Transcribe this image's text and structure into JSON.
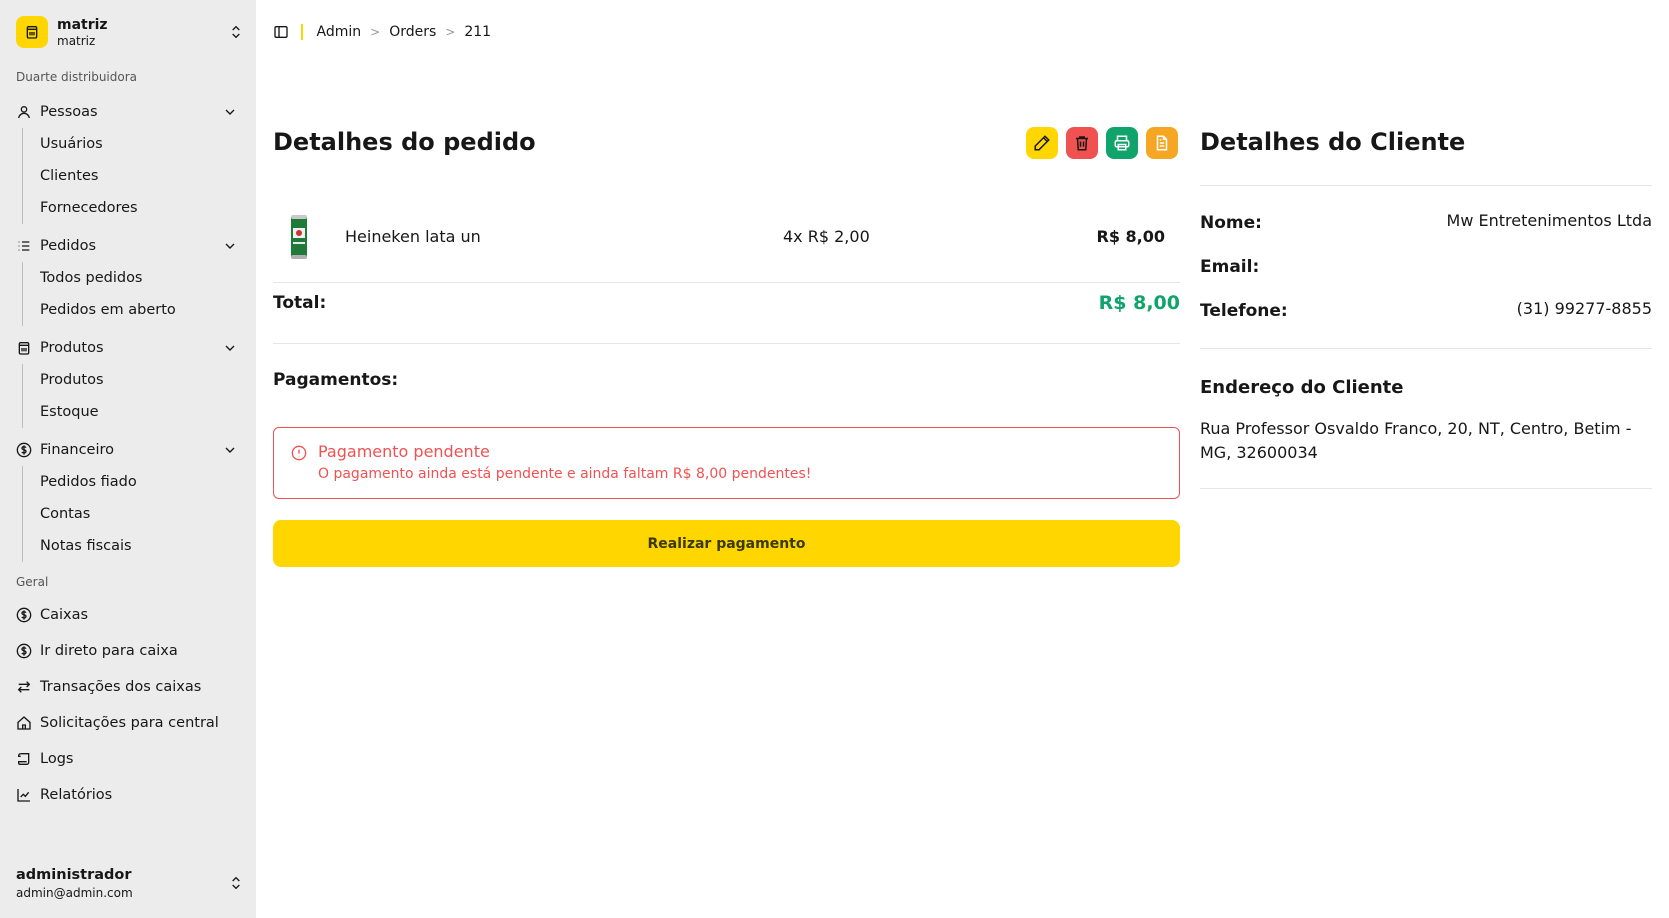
{
  "sidebar": {
    "store_name": "matriz",
    "store_sub": "matriz",
    "section_company": "Duarte distribuidora",
    "groups": [
      {
        "label": "Pessoas",
        "items": [
          "Usuários",
          "Clientes",
          "Fornecedores"
        ]
      },
      {
        "label": "Pedidos",
        "items": [
          "Todos pedidos",
          "Pedidos em aberto"
        ]
      },
      {
        "label": "Produtos",
        "items": [
          "Produtos",
          "Estoque"
        ]
      },
      {
        "label": "Financeiro",
        "items": [
          "Pedidos fiado",
          "Contas",
          "Notas fiscais"
        ]
      }
    ],
    "section_general": "Geral",
    "general_items": [
      "Caixas",
      "Ir direto para caixa",
      "Transações dos caixas",
      "Solicitações para central",
      "Logs",
      "Relatórios"
    ],
    "user": {
      "name": "administrador",
      "email": "admin@admin.com"
    }
  },
  "breadcrumb": [
    "Admin",
    "Orders",
    "211"
  ],
  "order": {
    "title": "Detalhes do pedido",
    "item": {
      "name": "Heineken lata un",
      "qty": "4x R$ 2,00",
      "total": "R$ 8,00"
    },
    "total_label": "Total:",
    "total_value": "R$ 8,00",
    "payments_label": "Pagamentos:",
    "alert_title": "Pagamento pendente",
    "alert_desc": "O pagamento ainda está pendente e ainda faltam R$ 8,00 pendentes!",
    "pay_button": "Realizar pagamento"
  },
  "client": {
    "title": "Detalhes do Cliente",
    "name_label": "Nome:",
    "name_value": "Mw Entretenimentos Ltda",
    "email_label": "Email:",
    "email_value": "",
    "phone_label": "Telefone:",
    "phone_value": "(31) 99277-8855",
    "address_title": "Endereço do Cliente",
    "address": "Rua Professor Osvaldo Franco, 20, NT, Centro, Betim - MG, 32600034"
  },
  "colors": {
    "accent": "#ffd600",
    "danger": "#f05252",
    "success": "#10a36b",
    "warning": "#f5a623"
  }
}
